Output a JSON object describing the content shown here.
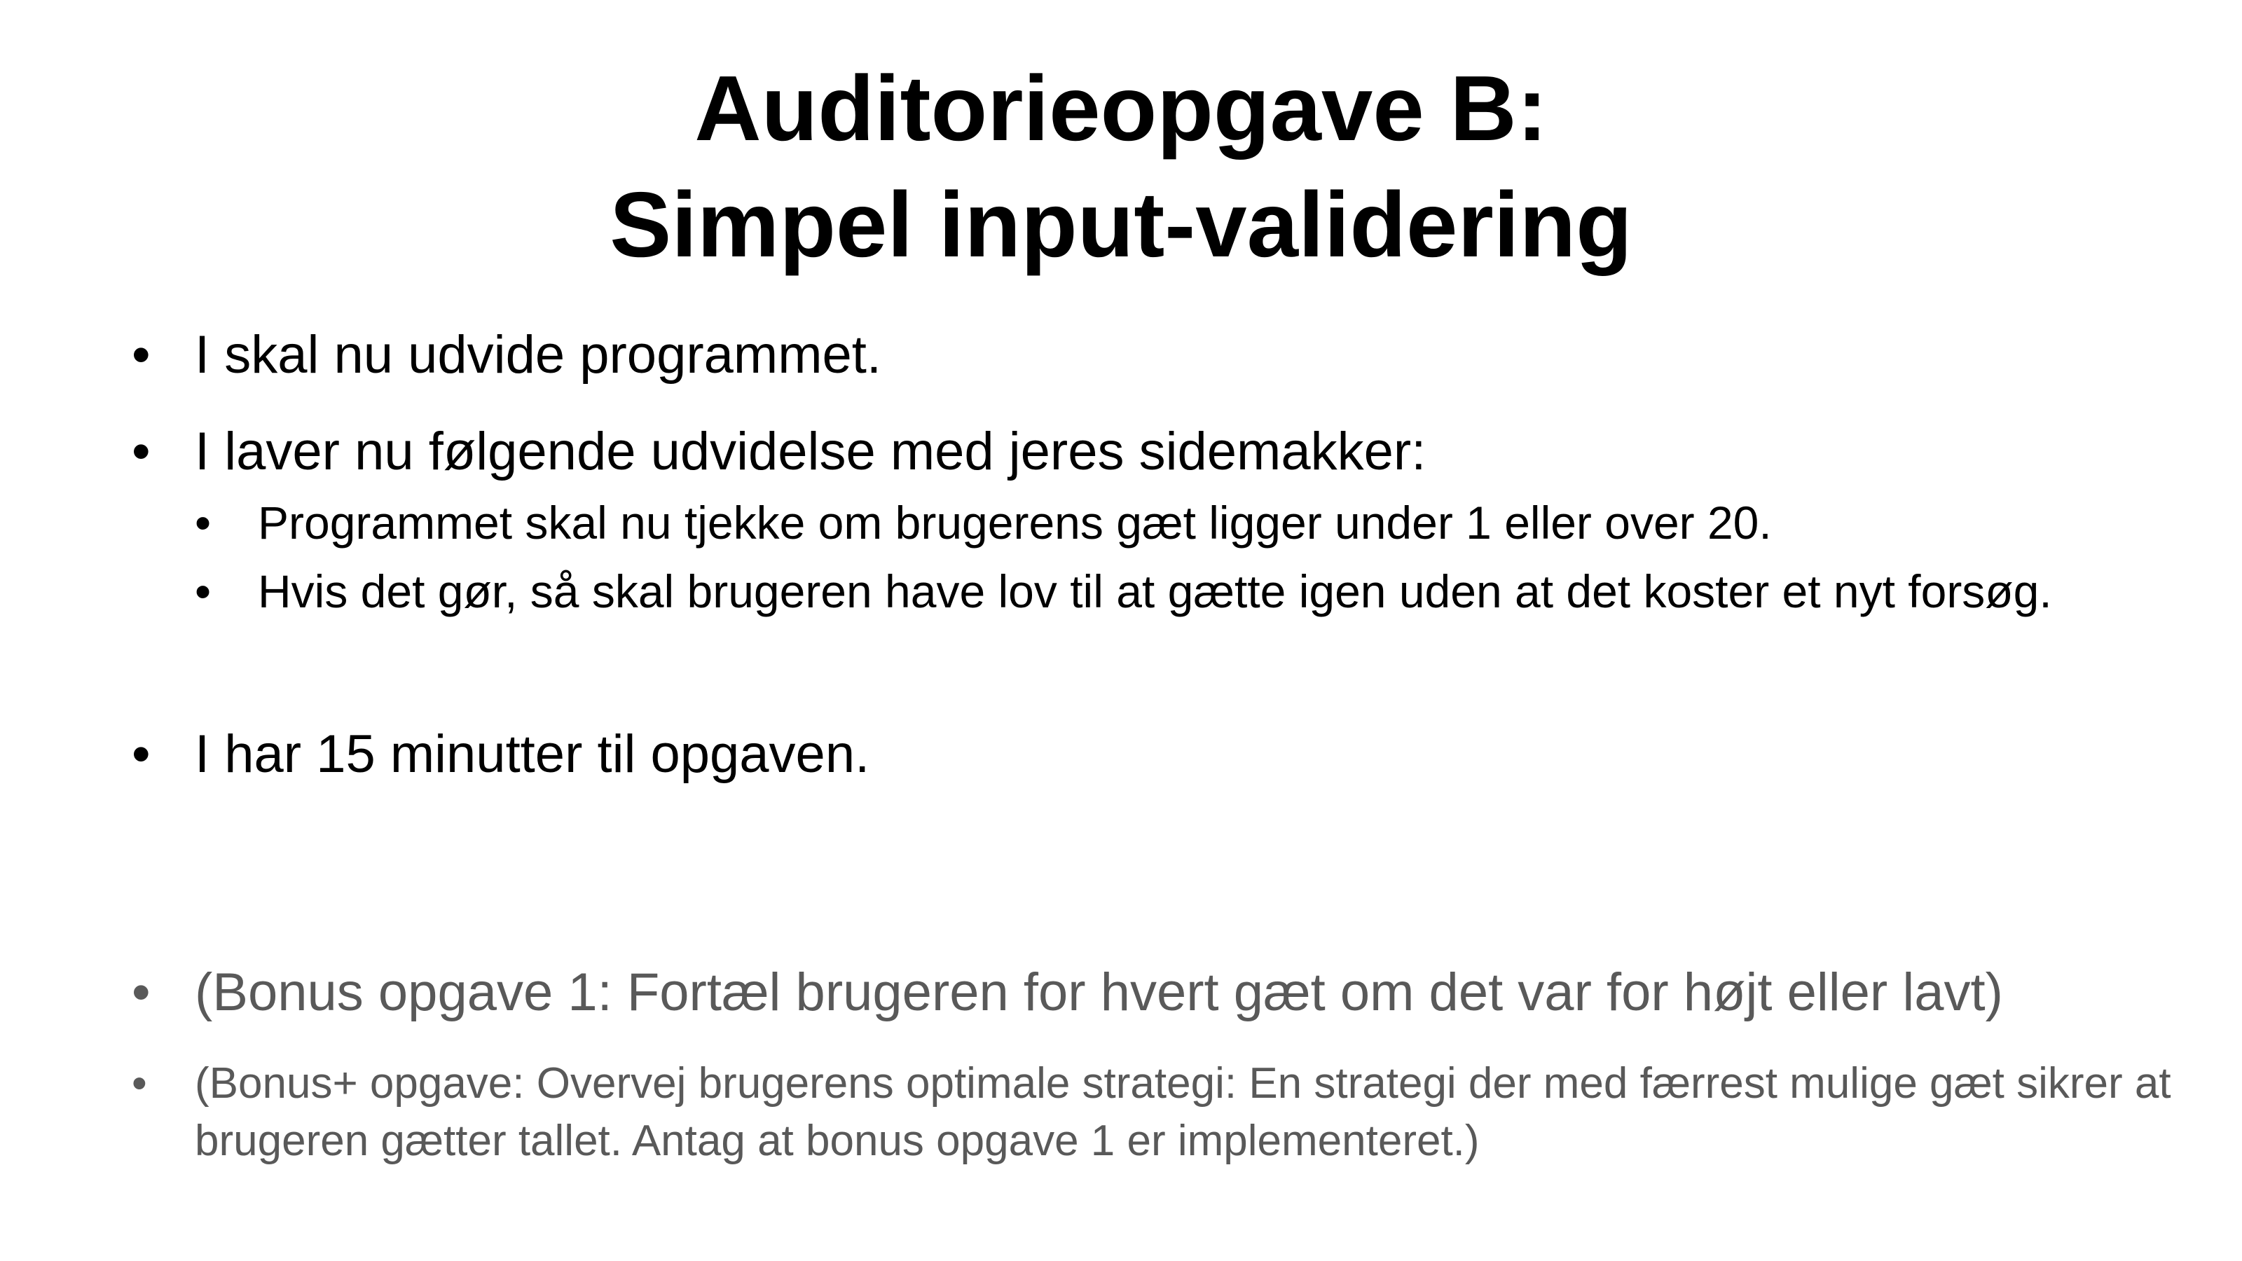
{
  "slide": {
    "title_line1": "Auditorieopgave B:",
    "title_line2": "Simpel input-validering",
    "bullet_glyph": "•",
    "bullets": [
      {
        "text": "I skal nu udvide programmet."
      },
      {
        "text": "I laver nu følgende udvidelse med jeres sidemakker:",
        "sub": [
          "Programmet skal nu tjekke om brugerens gæt ligger under 1 eller over 20.",
          "Hvis det gør, så skal brugeren have lov til at gætte igen uden at det koster et nyt forsøg."
        ]
      },
      {
        "text": "I har 15 minutter til opgaven."
      },
      {
        "text": "(Bonus opgave 1: Fortæl brugeren for hvert gæt om det var for højt eller lavt)"
      },
      {
        "text": "(Bonus+ opgave: Overvej brugerens optimale strategi: En strategi der med færrest mulige gæt sikrer at brugeren gætter tallet. Antag at bonus opgave 1 er implementeret.)"
      }
    ]
  },
  "colors": {
    "text": "#000000",
    "bonus_text": "#595959",
    "background": "#ffffff"
  }
}
